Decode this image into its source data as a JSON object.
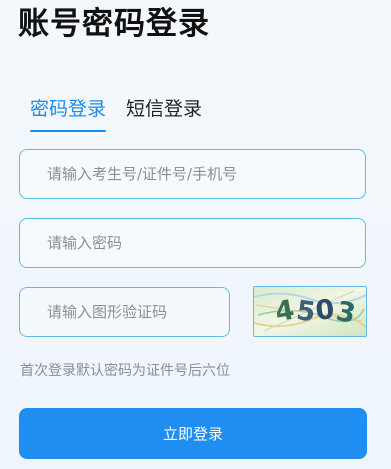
{
  "page": {
    "title": "账号密码登录"
  },
  "tabs": [
    {
      "label": "密码登录",
      "active": true
    },
    {
      "label": "短信登录",
      "active": false
    }
  ],
  "form": {
    "account_placeholder": "请输入考生号/证件号/手机号",
    "password_placeholder": "请输入密码",
    "captcha_placeholder": "请输入图形验证码",
    "captcha_text": "4503",
    "hint": "首次登录默认密码为证件号后六位",
    "submit_label": "立即登录"
  },
  "colors": {
    "accent": "#1a8ee8",
    "button": "#1f8ef0",
    "field_border": "#5dbde7"
  }
}
